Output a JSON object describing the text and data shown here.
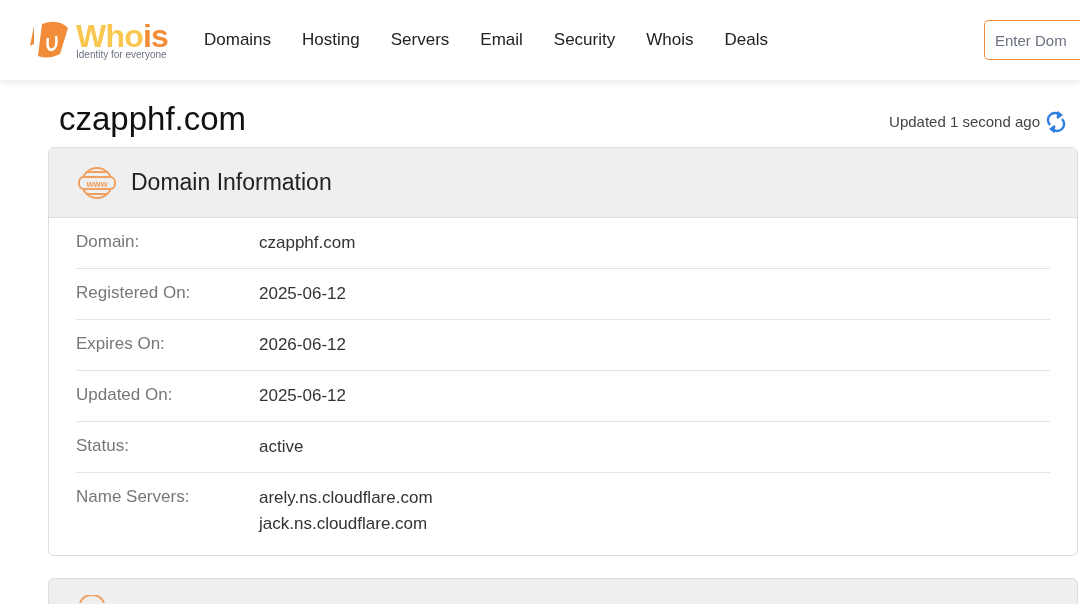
{
  "logo": {
    "name_start": "Who",
    "name_end": "is",
    "tagline": "Identity for everyone"
  },
  "nav": [
    "Domains",
    "Hosting",
    "Servers",
    "Email",
    "Security",
    "Whois",
    "Deals"
  ],
  "search": {
    "placeholder": "Enter Dom"
  },
  "domain_title": "czapphf.com",
  "updated": "Updated 1 second ago",
  "card": {
    "icon_text": "www",
    "title": "Domain Information",
    "rows": [
      {
        "label": "Domain:",
        "values": [
          "czapphf.com"
        ]
      },
      {
        "label": "Registered On:",
        "values": [
          "2025-06-12"
        ]
      },
      {
        "label": "Expires On:",
        "values": [
          "2026-06-12"
        ]
      },
      {
        "label": "Updated On:",
        "values": [
          "2025-06-12"
        ]
      },
      {
        "label": "Status:",
        "values": [
          "active"
        ]
      },
      {
        "label": "Name Servers:",
        "values": [
          "arely.ns.cloudflare.com",
          "jack.ns.cloudflare.com"
        ]
      }
    ]
  }
}
